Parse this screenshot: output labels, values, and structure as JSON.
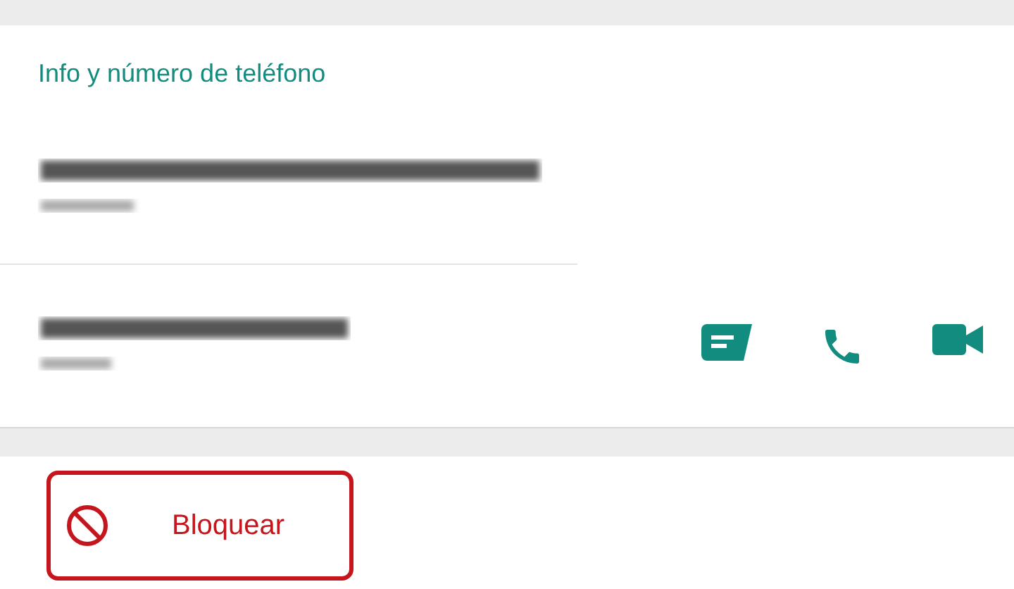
{
  "info": {
    "title": "Info y número de teléfono",
    "entries": [
      {
        "kind": "about",
        "lines": [
          {
            "kind": "long"
          },
          {
            "kind": "short"
          }
        ]
      },
      {
        "kind": "phone",
        "lines": [
          {
            "kind": "medium"
          },
          {
            "kind": "tiny"
          }
        ],
        "actions": [
          {
            "kind": "message"
          },
          {
            "kind": "call"
          },
          {
            "kind": "video"
          }
        ]
      }
    ]
  },
  "block_button": {
    "label": "Bloquear"
  }
}
